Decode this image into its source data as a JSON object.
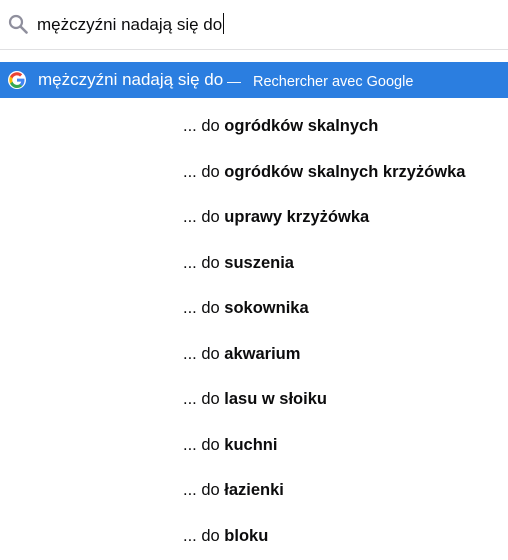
{
  "search": {
    "value": "mężczyźni nadają się do",
    "icon": "search-icon"
  },
  "google_row": {
    "icon": "google-icon",
    "query": "mężczyźni nadają się do",
    "separator": "—",
    "action": "Rechercher avec Google",
    "highlight_color": "#2b7ee0"
  },
  "suggestions": [
    {
      "prefix": "... do ",
      "completion": "ogródków skalnych"
    },
    {
      "prefix": "... do ",
      "completion": "ogródków skalnych krzyżówka"
    },
    {
      "prefix": "... do ",
      "completion": "uprawy krzyżówka"
    },
    {
      "prefix": "... do ",
      "completion": "suszenia"
    },
    {
      "prefix": "... do ",
      "completion": "sokownika"
    },
    {
      "prefix": "... do ",
      "completion": "akwarium"
    },
    {
      "prefix": "... do ",
      "completion": "lasu w słoiku"
    },
    {
      "prefix": "... do ",
      "completion": "kuchni"
    },
    {
      "prefix": "... do ",
      "completion": "łazienki"
    },
    {
      "prefix": "... do ",
      "completion": "bloku"
    }
  ]
}
